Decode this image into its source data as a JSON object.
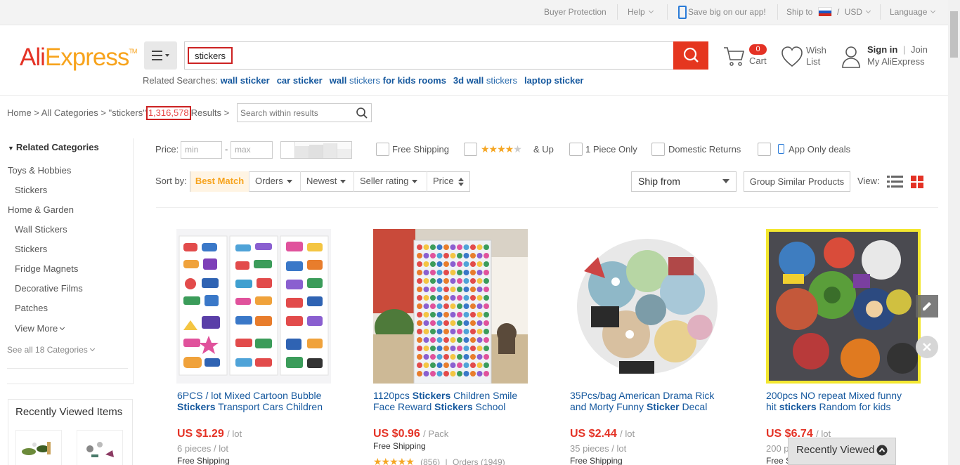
{
  "topbar": {
    "buyer_protection": "Buyer Protection",
    "help": "Help",
    "app_promo": "Save big on our app!",
    "ship_to": "Ship to",
    "ship_sep": "/",
    "currency": "USD",
    "language": "Language"
  },
  "header": {
    "logo_ali": "Ali",
    "logo_express": "Express",
    "logo_tm": "TM",
    "search_value": "stickers",
    "cart_count": "0",
    "cart_label": "Cart",
    "wish_label_1": "Wish",
    "wish_label_2": "List",
    "sign_in": "Sign in",
    "join_sep": "|",
    "join": "Join",
    "my_account": "My AliExpress"
  },
  "related": {
    "label": "Related Searches:",
    "items": [
      {
        "bold": "wall sticker",
        "rest": ""
      },
      {
        "bold": "car sticker",
        "rest": ""
      },
      {
        "bold": "wall",
        "rest": " stickers ",
        "bold2": "for kids rooms"
      },
      {
        "bold": "3d wall",
        "rest": " stickers",
        "bold2": ""
      },
      {
        "bold": "laptop sticker",
        "rest": ""
      }
    ]
  },
  "breadcrumb": {
    "text": "Home > All Categories > \"stickers\"",
    "count": "1,316,578",
    "results": "Results >",
    "search_within_placeholder": "Search within results"
  },
  "sidebar": {
    "title": "Related Categories",
    "items": [
      {
        "label": "Toys & Hobbies",
        "level": "top"
      },
      {
        "label": "Stickers",
        "level": "sub"
      },
      {
        "label": "Home & Garden",
        "level": "top"
      },
      {
        "label": "Wall Stickers",
        "level": "sub"
      },
      {
        "label": "Stickers",
        "level": "sub"
      },
      {
        "label": "Fridge Magnets",
        "level": "sub"
      },
      {
        "label": "Decorative Films",
        "level": "sub"
      },
      {
        "label": "Patches",
        "level": "sub"
      }
    ],
    "view_more": "View More",
    "see_all": "See all 18 Categories",
    "recent_title": "Recently Viewed Items"
  },
  "filters": {
    "price_label": "Price:",
    "price_min": "min",
    "price_dash": "-",
    "price_max": "max",
    "free_shipping": "Free Shipping",
    "rating_up": "& Up",
    "one_piece": "1 Piece Only",
    "domestic_returns": "Domestic Returns",
    "app_only": "App Only deals",
    "sort_label": "Sort by:",
    "sort_best": "Best Match",
    "sort_orders": "Orders",
    "sort_newest": "Newest",
    "sort_seller": "Seller rating",
    "sort_price": "Price",
    "ship_from": "Ship from",
    "group_similar": "Group Similar Products",
    "view_label": "View:"
  },
  "products": [
    {
      "title_1": "6PCS / lot Mixed Cartoon Bubble",
      "title_bold": "Stickers",
      "title_2": " Transport Cars Children",
      "price": "US $1.29",
      "unit": "/ lot",
      "min": "6 pieces / lot",
      "shipping": "Free Shipping"
    },
    {
      "title_1": "1120pcs ",
      "title_bold": "Stickers",
      "title_2": " Children Smile",
      "title_3": "Face Reward ",
      "title_bold2": "Stickers",
      "title_4": " School",
      "price": "US $0.96",
      "unit": "/ Pack",
      "shipping": "Free Shipping",
      "rating_count": "(856)",
      "orders": "Orders (1949)"
    },
    {
      "title_1": "35Pcs/bag American Drama Rick",
      "title_2": "and Morty Funny ",
      "title_bold": "Sticker",
      "title_3": " Decal",
      "price": "US $2.44",
      "unit": "/ lot",
      "min": "35 pieces / lot",
      "shipping": "Free Shipping"
    },
    {
      "title_1": "200pcs NO repeat Mixed funny",
      "title_2": "hit ",
      "title_bold": "stickers",
      "title_3": " Random for kids",
      "price": "US $6.74",
      "unit": "/ lot",
      "min": "200 p",
      "shipping": "Free S"
    }
  ],
  "recently_viewed_bar": "Recently Viewed",
  "colors": {
    "brand_red": "#e43225",
    "brand_orange": "#f7a31c",
    "link_blue": "#15589e",
    "highlight_yellow": "#f3e730"
  }
}
